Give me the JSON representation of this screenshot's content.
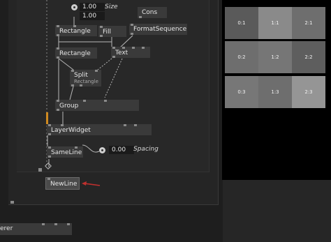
{
  "nodes": {
    "cons": "Cons",
    "rectangle_1": "Rectangle",
    "fill": "Fill",
    "format_sequence": "FormatSequence",
    "rectangle_2": "Rectangle",
    "text": "Text",
    "split": "Split",
    "split_sub": "Rectangle",
    "group": "Group",
    "layer_widget": "LayerWidget",
    "same_line": "SameLine",
    "new_line": "NewLine",
    "renderer": "erer"
  },
  "values": {
    "size_x": "1.00",
    "size_y": "1.00",
    "size_label": "Size",
    "spacing_value": "0.00",
    "spacing_label": "Spacing"
  },
  "grid": {
    "rows": [
      [
        "0:1",
        "1:1",
        "2:1"
      ],
      [
        "0:2",
        "1:2",
        "2:2"
      ],
      [
        "0:3",
        "1:3",
        "2:3"
      ]
    ],
    "colors": [
      [
        "#5a5a5a",
        "#8a8a8a",
        "#6e6e6e"
      ],
      [
        "#6e6e6e",
        "#767676",
        "#5e5e5e"
      ],
      [
        "#777777",
        "#6e6e6e",
        "#959595"
      ]
    ]
  },
  "colors": {
    "accent_arrow": "#c0302e",
    "node_bg": "#3a3a3a"
  }
}
